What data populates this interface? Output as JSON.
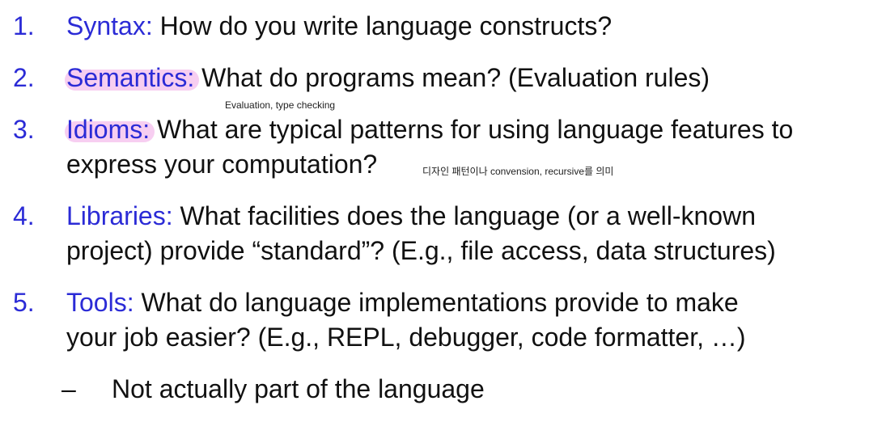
{
  "items": [
    {
      "num": "1.",
      "keyword": "Syntax:",
      "lines": [
        "How do you write language constructs?"
      ]
    },
    {
      "num": "2.",
      "keyword": "Semantics:",
      "lines": [
        "What do programs mean? (Evaluation rules)"
      ]
    },
    {
      "num": "3.",
      "keyword": "Idioms:",
      "lines": [
        "What are typical patterns for using language features to",
        "express your computation?"
      ]
    },
    {
      "num": "4.",
      "keyword": "Libraries:",
      "lines": [
        "What facilities does the language (or a well-known",
        "project) provide “standard”? (E.g., file access, data structures)"
      ]
    },
    {
      "num": "5.",
      "keyword": "Tools:",
      "lines": [
        "What do language implementations provide to make",
        "your job easier? (E.g., REPL, debugger, code formatter, …)"
      ]
    }
  ],
  "sub_items": [
    {
      "bullet": "–",
      "text": "Not actually part of the language"
    }
  ],
  "notes": {
    "semantics_note": "Evaluation, type checking",
    "idioms_note": "디자인 패턴이나 convension, recursive를 의미"
  },
  "colors": {
    "accent": "#2b2bd6",
    "text": "#111111",
    "highlight": "#f6c6ee"
  }
}
